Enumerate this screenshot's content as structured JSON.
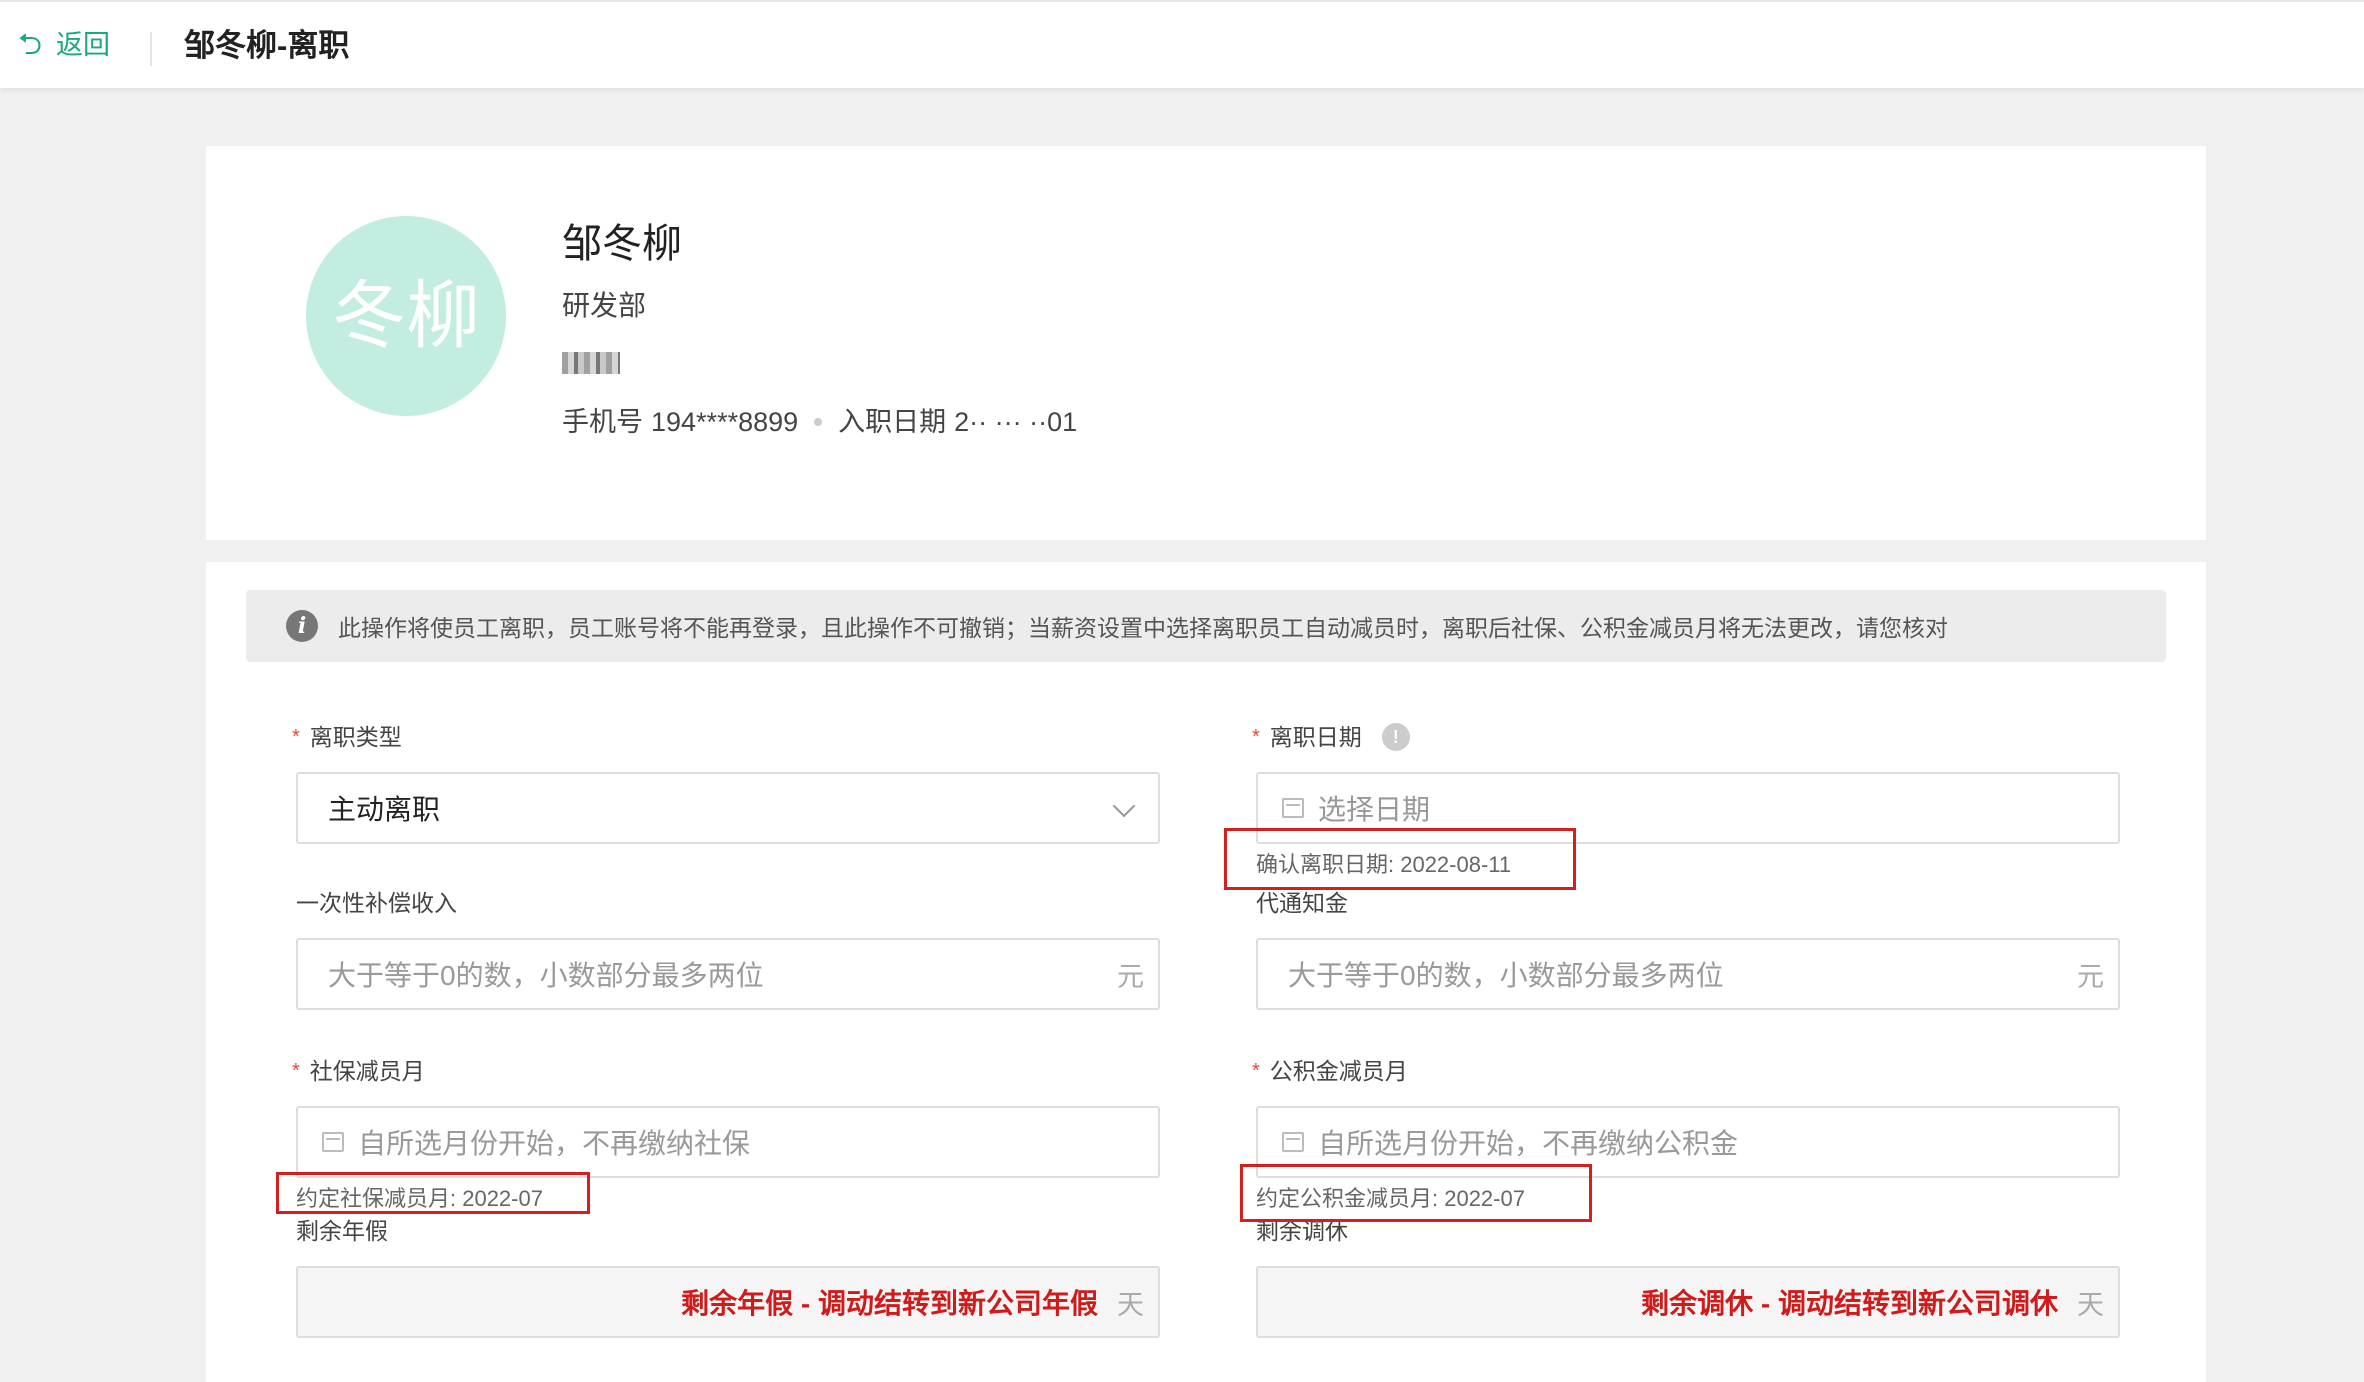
{
  "header": {
    "back_label": "返回",
    "page_title": "邹冬柳-离职"
  },
  "profile": {
    "avatar_text": "冬柳",
    "name": "邹冬柳",
    "department": "研发部",
    "phone_label": "手机号",
    "phone_value": "194****8899",
    "hire_date_label": "入职日期",
    "hire_date_value": "2·· ··· ··01"
  },
  "notice": "此操作将使员工离职，员工账号将不能再登录，且此操作不可撤销；当薪资设置中选择离职员工自动减员时，离职后社保、公积金减员月将无法更改，请您核对",
  "form": {
    "leave_type": {
      "label": "离职类型",
      "value": "主动离职"
    },
    "leave_date": {
      "label": "离职日期",
      "placeholder": "选择日期",
      "hint": "确认离职日期: 2022-08-11"
    },
    "severance": {
      "label": "一次性补偿收入",
      "placeholder": "大于等于0的数，小数部分最多两位",
      "unit": "元"
    },
    "notice_pay": {
      "label": "代通知金",
      "placeholder": "大于等于0的数，小数部分最多两位",
      "unit": "元"
    },
    "social_month": {
      "label": "社保减员月",
      "placeholder": "自所选月份开始，不再缴纳社保",
      "hint": "约定社保减员月: 2022-07"
    },
    "fund_month": {
      "label": "公积金减员月",
      "placeholder": "自所选月份开始，不再缴纳公积金",
      "hint": "约定公积金减员月: 2022-07"
    },
    "annual_leave": {
      "label": "剩余年假",
      "value": "剩余年假 - 调动结转到新公司年假",
      "unit": "天"
    },
    "comp_leave": {
      "label": "剩余调休",
      "value": "剩余调休 - 调动结转到新公司调休",
      "unit": "天"
    }
  },
  "colors": {
    "accent": "#1ba97b",
    "required": "#e0473b",
    "annotation": "#d71e1e"
  }
}
